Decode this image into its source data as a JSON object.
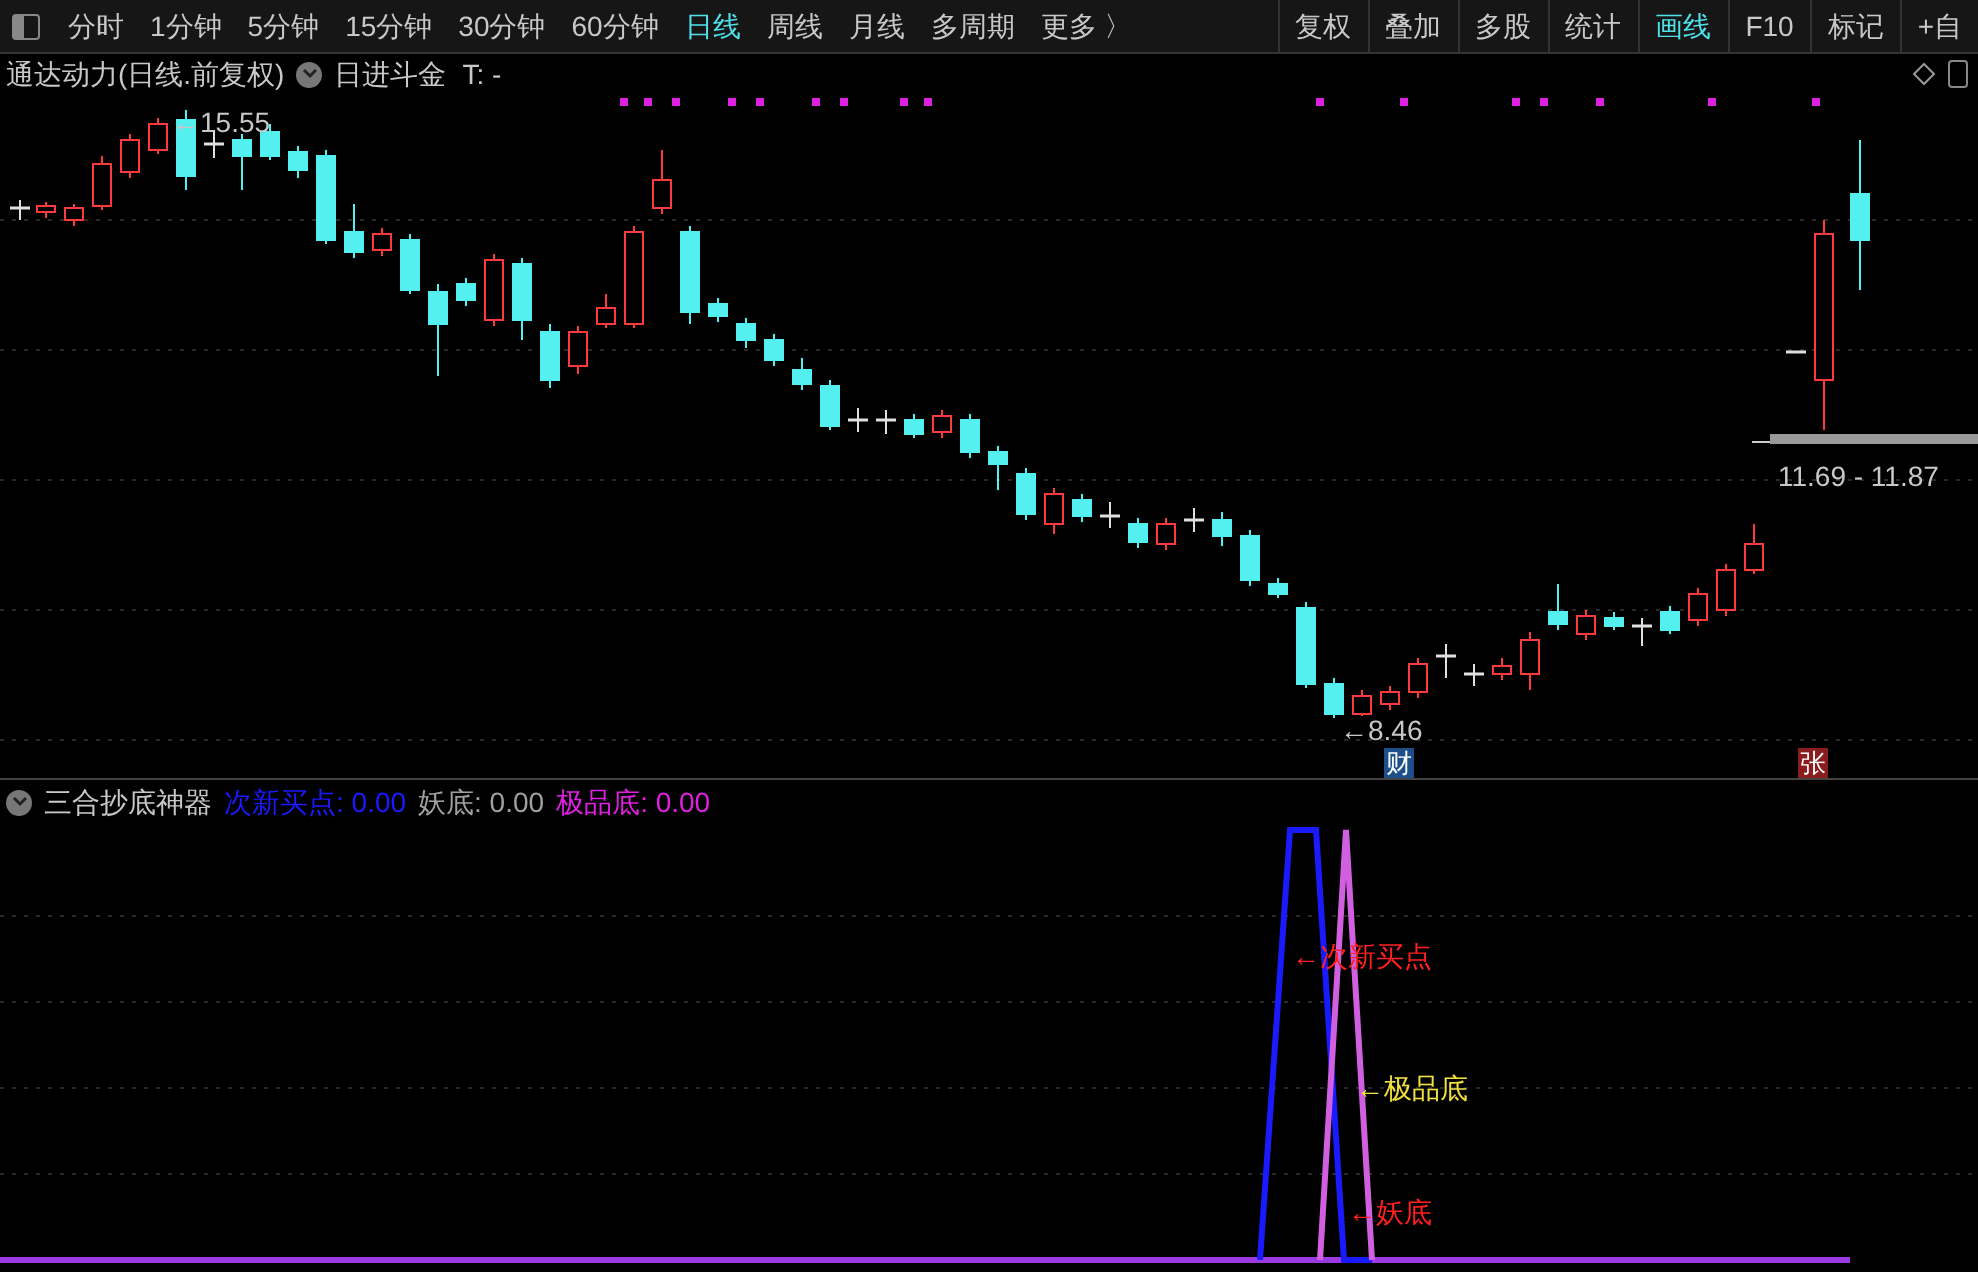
{
  "toolbar": {
    "periods": [
      {
        "label": "分时",
        "selected": false
      },
      {
        "label": "1分钟",
        "selected": false
      },
      {
        "label": "5分钟",
        "selected": false
      },
      {
        "label": "15分钟",
        "selected": false
      },
      {
        "label": "30分钟",
        "selected": false
      },
      {
        "label": "60分钟",
        "selected": false
      },
      {
        "label": "日线",
        "selected": true
      },
      {
        "label": "周线",
        "selected": false
      },
      {
        "label": "月线",
        "selected": false
      },
      {
        "label": "多周期",
        "selected": false
      },
      {
        "label": "更多 〉",
        "selected": false
      }
    ],
    "tools": [
      {
        "label": "复权",
        "selected": false
      },
      {
        "label": "叠加",
        "selected": false
      },
      {
        "label": "多股",
        "selected": false
      },
      {
        "label": "统计",
        "selected": false
      },
      {
        "label": "画线",
        "selected": true
      },
      {
        "label": "F10",
        "selected": false
      },
      {
        "label": "标记",
        "selected": false
      },
      {
        "label": "+自",
        "selected": false
      }
    ]
  },
  "info_bar": {
    "stock": "通达动力(日线.前复权)",
    "indicator": "日进斗金",
    "reading": "T: -"
  },
  "main_chart": {
    "high_label": "←15.55",
    "low_label": "←8.46",
    "range_label": "11.69 - 11.87",
    "badges": [
      {
        "text": "财",
        "color": "#1d4f8a"
      },
      {
        "text": "张",
        "color": "#8a1d1d"
      }
    ]
  },
  "indicator_panel": {
    "title": "三合抄底神器",
    "legend": [
      {
        "label": "次新买点: 0.00",
        "color": "#1a1aff"
      },
      {
        "label": "妖底: 0.00",
        "color": "#a0a0a0"
      },
      {
        "label": "极品底: 0.00",
        "color": "#e020e0"
      }
    ],
    "annotations": [
      {
        "text": "←次新买点",
        "color": "#ff2020"
      },
      {
        "text": "←极品底",
        "color": "#f0e040"
      },
      {
        "text": "←妖底",
        "color": "#ff2020"
      }
    ]
  }
}
